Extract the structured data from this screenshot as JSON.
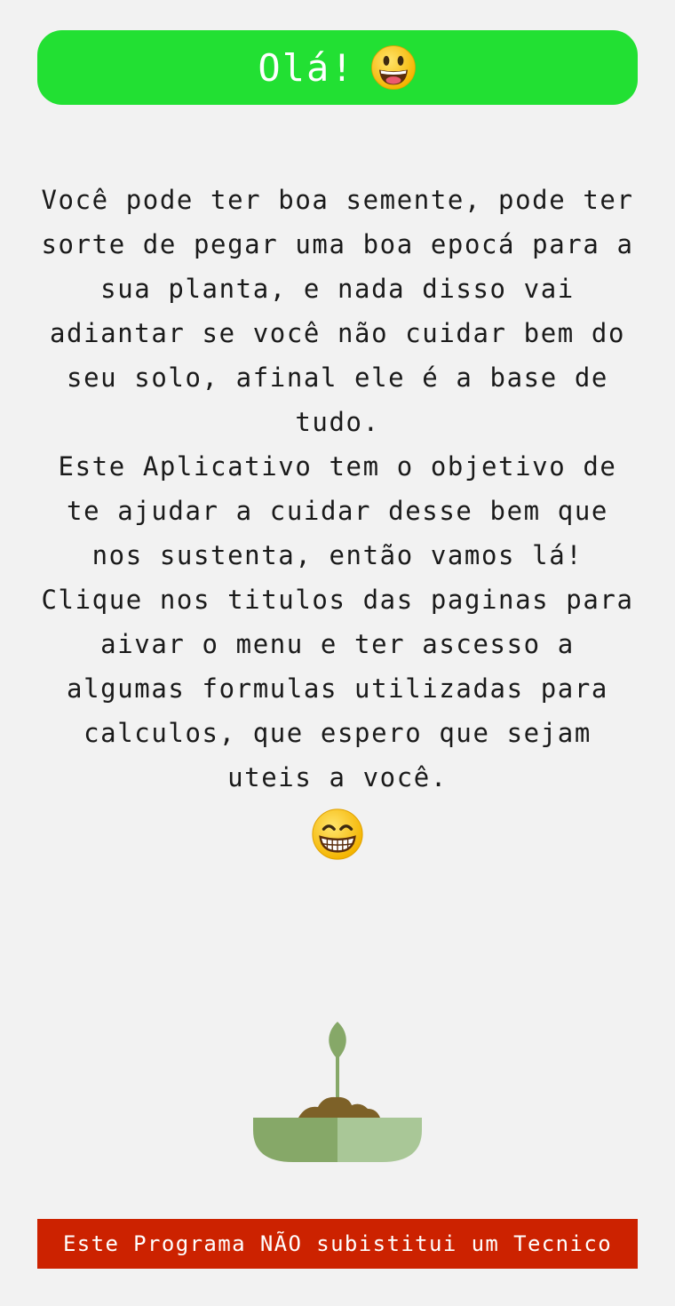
{
  "header": {
    "title": "Olá!",
    "emoji_icon": "smiley-face-icon",
    "background_color": "#22e033"
  },
  "intro": {
    "paragraphs": [
      "Você pode ter boa semente, pode ter sorte de pegar uma boa epocá para a sua planta, e nada disso vai adiantar se você não cuidar bem do seu solo, afinal ele é a base de tudo.",
      "Este Aplicativo tem o objetivo de te ajudar a cuidar desse bem que nos sustenta, então vamos lá!",
      "Clique nos titulos das paginas para aivar o menu e ter ascesso a algumas formulas utilizadas para calculos, que espero que sejam uteis a você."
    ],
    "closing_emoji_icon": "grinning-face-icon"
  },
  "illustration": {
    "icon": "sprout-in-pot-icon"
  },
  "footer": {
    "disclaimer": "Este Programa NÃO subistitui um Tecnico",
    "background_color": "#cc2200"
  }
}
